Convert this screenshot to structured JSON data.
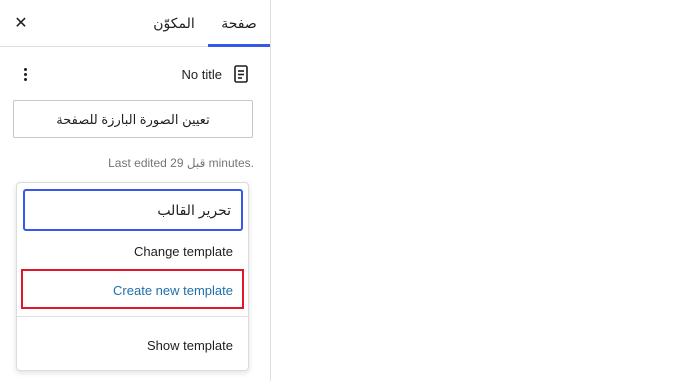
{
  "sidebar": {
    "tabs": [
      {
        "label": "صفحة"
      },
      {
        "label": "المكوّن"
      }
    ],
    "close_icon": "close-icon",
    "document": {
      "title": "No title",
      "icon": "page-icon",
      "more_icon": "more-vertical-icon"
    },
    "featured_image_button": "تعيين الصورة البارزة للصفحة",
    "last_edited": "Last edited قبل 29 minutes."
  },
  "template_menu": {
    "edit_template": "تحرير القالب",
    "change_template": "Change template",
    "create_new_template": "Create new template",
    "show_template": "Show template",
    "highlight_color": "#e0162b"
  },
  "colors": {
    "accent": "#3858e9",
    "link": "#1f6fa8"
  }
}
